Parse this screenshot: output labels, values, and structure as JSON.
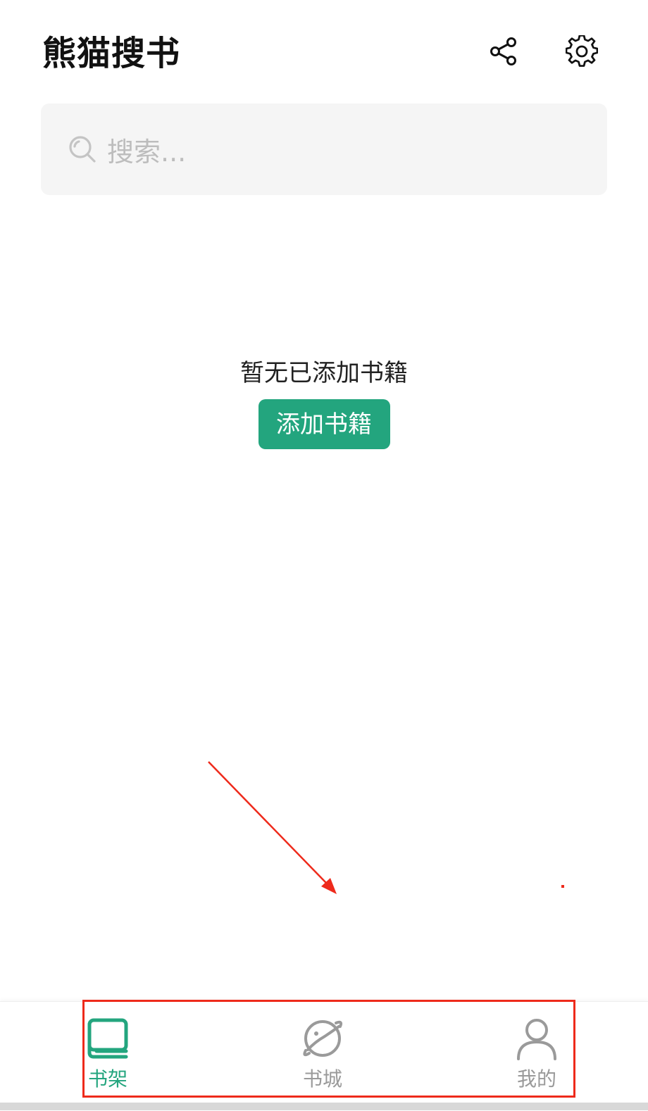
{
  "header": {
    "title": "熊猫搜书",
    "share_icon": "share-icon",
    "settings_icon": "gear-icon"
  },
  "search": {
    "placeholder": "搜索...",
    "icon": "search-icon"
  },
  "empty_state": {
    "message": "暂无已添加书籍",
    "button_label": "添加书籍"
  },
  "bottom_nav": {
    "items": [
      {
        "label": "书架",
        "icon": "bookshelf-icon",
        "active": true
      },
      {
        "label": "书城",
        "icon": "planet-icon",
        "active": false
      },
      {
        "label": "我的",
        "icon": "user-icon",
        "active": false
      }
    ]
  },
  "colors": {
    "accent": "#23a57e",
    "inactive": "#9a9a9a",
    "annotation": "#ee2a1b",
    "search_bg": "#f5f5f5"
  }
}
